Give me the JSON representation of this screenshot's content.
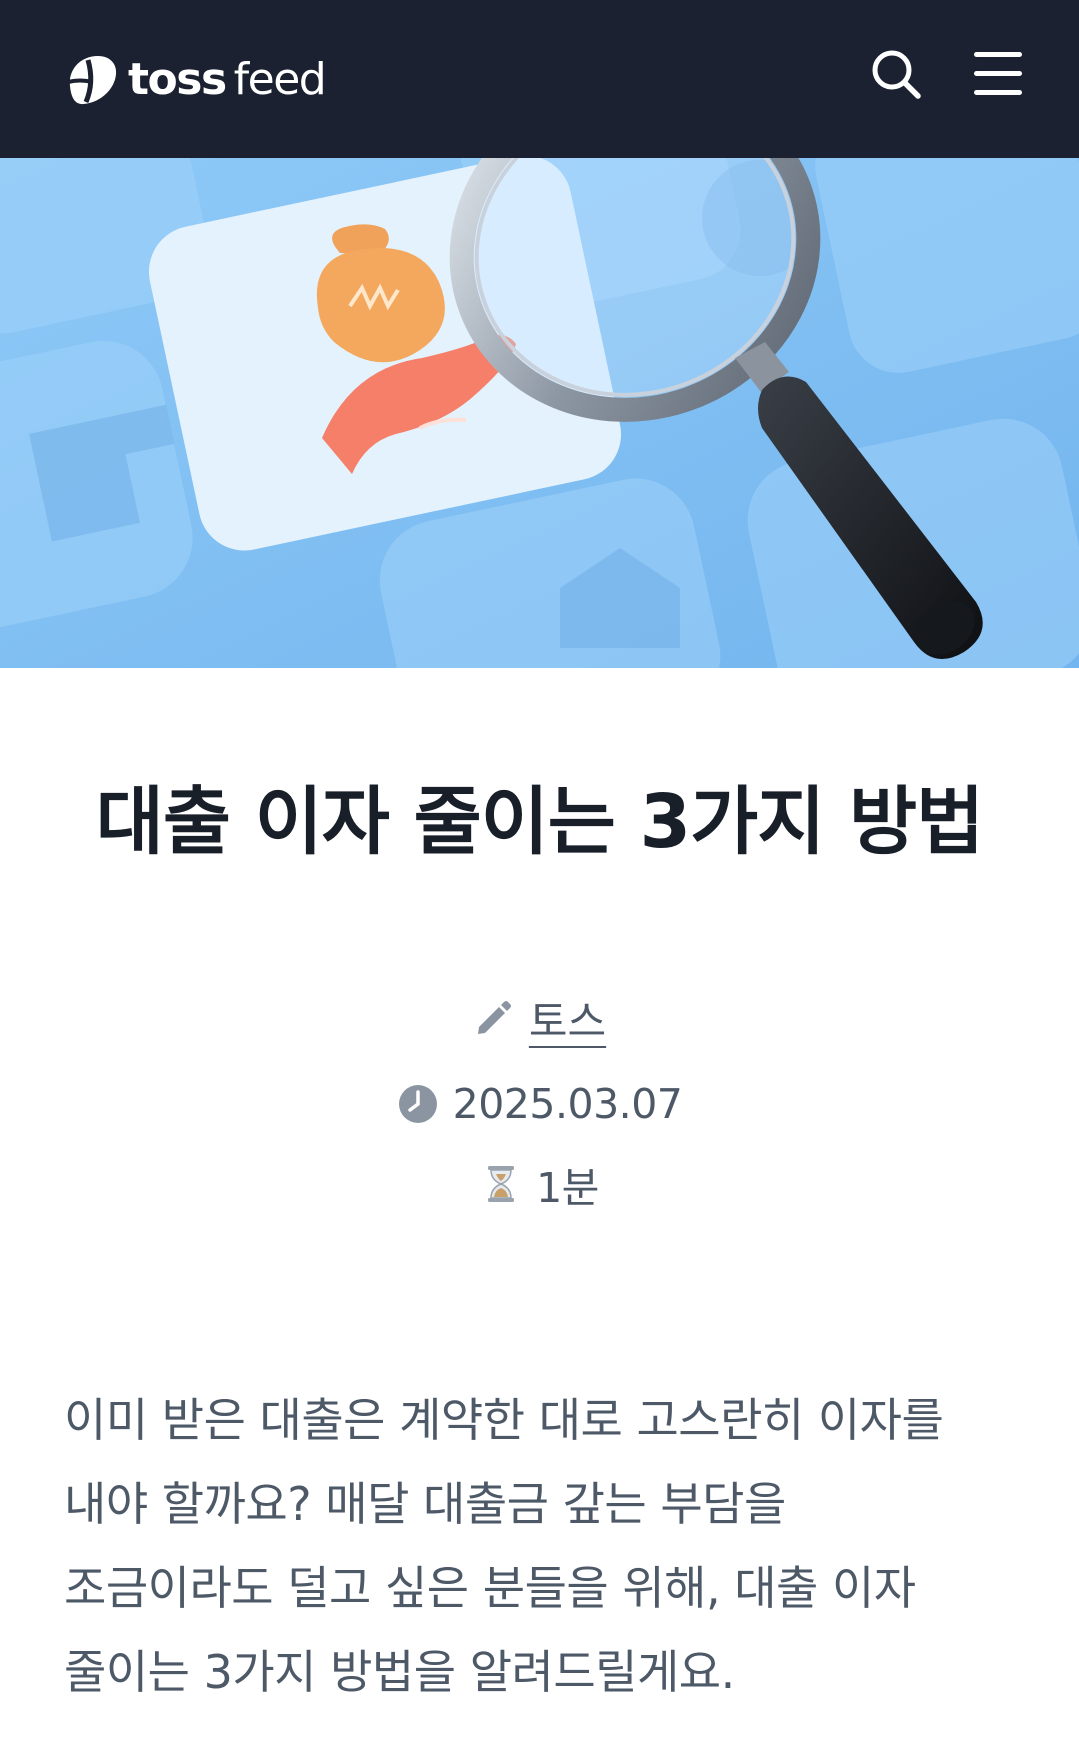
{
  "header": {
    "logo_bold": "toss",
    "logo_light": "feed",
    "search_icon": "search-icon",
    "menu_icon": "hamburger-menu-icon",
    "background": "#1b2130"
  },
  "hero": {
    "illustration": "magnifying-glass-over-loan-card",
    "background": "#87c4f4"
  },
  "article": {
    "title": "대출 이자 줄이는 3가지 방법",
    "author": "토스",
    "date": "2025.03.07",
    "read_time": "1분",
    "intro_lines": [
      "이미 받은 대출은 계약한 대로 고스란히 이자를",
      "내야 할까요? 매달 대출금 갚는 부담을",
      "조금이라도 덜고 싶은 분들을 위해, 대출 이자",
      "줄이는 3가지 방법을 알려드릴게요."
    ]
  },
  "colors": {
    "text_primary": "#191f28",
    "text_secondary": "#4e5968",
    "icon_gray": "#8b95a1"
  }
}
